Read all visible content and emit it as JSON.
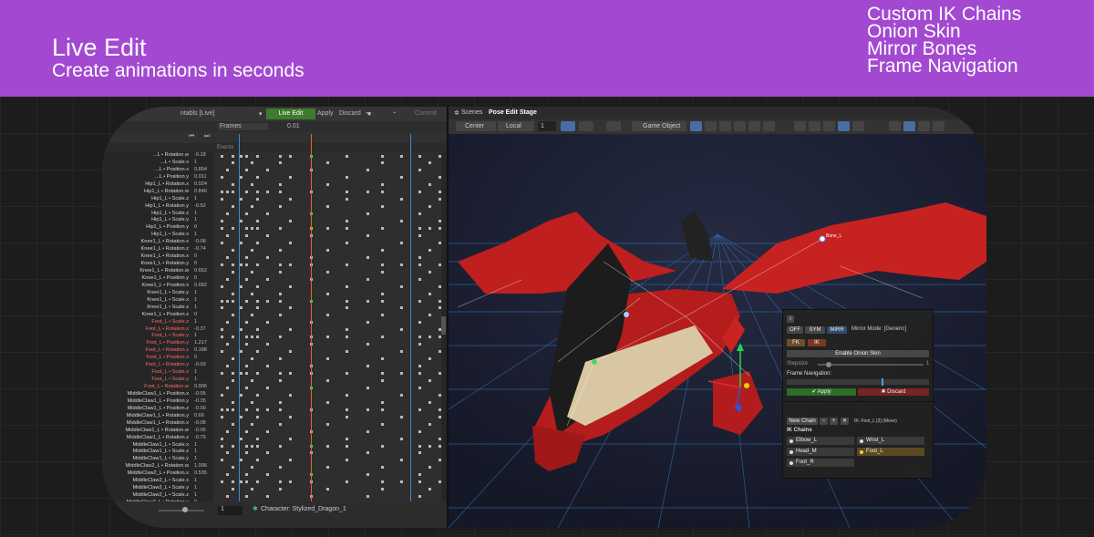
{
  "banner": {
    "title": "Live Edit",
    "subtitle": "Create animations in seconds",
    "features": [
      "Custom IK Chains",
      "Onion Skin",
      "Mirror Bones",
      "Frame Navigation"
    ],
    "bg_color": "#a349d1"
  },
  "animation_window": {
    "clip_label": "ntabls [Live]",
    "live_edit_label": "Live Edit",
    "apply_label": "Apply",
    "discard_label": "Discard",
    "commit_label": "Commit",
    "frames_label": "Frames",
    "frame_value": "0.01",
    "events_label": "Events",
    "properties": [
      {
        "name": "...L • Rotation.w",
        "value": "-0.18",
        "red": false
      },
      {
        "name": "...L • Scale.x",
        "value": "1",
        "red": false
      },
      {
        "name": "...L • Position.x",
        "value": "0.894",
        "red": false
      },
      {
        "name": "...L • Position.y",
        "value": "0.011",
        "red": false
      },
      {
        "name": "Hip1_L • Rotation.x",
        "value": "0.024",
        "red": false
      },
      {
        "name": "Hip1_L • Rotation.w",
        "value": "0.846",
        "red": false
      },
      {
        "name": "Hip1_L • Scale.z",
        "value": "1",
        "red": false
      },
      {
        "name": "Hip1_L • Rotation.y",
        "value": "-0.52",
        "red": false
      },
      {
        "name": "Hip1_L • Scale.z",
        "value": "1",
        "red": false
      },
      {
        "name": "Hip1_L • Scale.y",
        "value": "1",
        "red": false
      },
      {
        "name": "Hip1_L • Position.y",
        "value": "0",
        "red": false
      },
      {
        "name": "Hip1_L • Scale.x",
        "value": "1",
        "red": false
      },
      {
        "name": "Knee1_L • Rotation.x",
        "value": "-0.08",
        "red": false
      },
      {
        "name": "Knee1_L • Rotation.z",
        "value": "-0.74",
        "red": false
      },
      {
        "name": "Knee1_L • Rotation.x",
        "value": "0",
        "red": false
      },
      {
        "name": "Knee1_L • Rotation.y",
        "value": "0",
        "red": false
      },
      {
        "name": "Knee1_L • Rotation.w",
        "value": "0.662",
        "red": false
      },
      {
        "name": "Knee1_L • Position.y",
        "value": "0",
        "red": false
      },
      {
        "name": "Knee1_L • Position.x",
        "value": "0.682",
        "red": false
      },
      {
        "name": "Knee1_L • Scale.y",
        "value": "1",
        "red": false
      },
      {
        "name": "Knee1_L • Scale.x",
        "value": "1",
        "red": false
      },
      {
        "name": "Knee1_L • Scale.z",
        "value": "1",
        "red": false
      },
      {
        "name": "Knee1_L • Position.z",
        "value": "0",
        "red": false
      },
      {
        "name": "Foot_L • Scale.z",
        "value": "1",
        "red": true
      },
      {
        "name": "Foot_L • Rotation.x",
        "value": "-0.37",
        "red": true
      },
      {
        "name": "Foot_L • Scale.y",
        "value": "1",
        "red": true
      },
      {
        "name": "Foot_L • Position.y",
        "value": "1.217",
        "red": true
      },
      {
        "name": "Foot_L • Rotation.z",
        "value": "0.188",
        "red": true
      },
      {
        "name": "Foot_L • Position.x",
        "value": "0",
        "red": true
      },
      {
        "name": "Foot_L • Rotation.y",
        "value": "-0.03",
        "red": true
      },
      {
        "name": "Foot_L • Scale.x",
        "value": "1",
        "red": true
      },
      {
        "name": "Foot_L • Scale.y",
        "value": "1",
        "red": true
      },
      {
        "name": "Foot_L • Rotation.w",
        "value": "0.906",
        "red": true
      },
      {
        "name": "MiddleClaw1_L • Position.x",
        "value": "-0.05",
        "red": false
      },
      {
        "name": "MiddleClaw1_L • Position.y",
        "value": "-0.35",
        "red": false
      },
      {
        "name": "MiddleClaw1_L • Position.z",
        "value": "-0.00",
        "red": false
      },
      {
        "name": "MiddleClaw1_L • Rotation.y",
        "value": "0.66",
        "red": false
      },
      {
        "name": "MiddleClaw1_L • Rotation.x",
        "value": "-0.08",
        "red": false
      },
      {
        "name": "MiddleClaw1_L • Rotation.w",
        "value": "-0.05",
        "red": false
      },
      {
        "name": "MiddleClaw1_L • Rotation.z",
        "value": "-0.75",
        "red": false
      },
      {
        "name": "MiddleClaw1_L • Scale.x",
        "value": "1",
        "red": false
      },
      {
        "name": "MiddleClaw1_L • Scale.z",
        "value": "1",
        "red": false
      },
      {
        "name": "MiddleClaw1_L • Scale.y",
        "value": "1",
        "red": false
      },
      {
        "name": "MiddleClaw2_L • Rotation.w",
        "value": "1.006",
        "red": false
      },
      {
        "name": "MiddleClaw2_L • Position.x",
        "value": "0.535",
        "red": false
      },
      {
        "name": "MiddleClaw2_L • Scale.x",
        "value": "1",
        "red": false
      },
      {
        "name": "MiddleClaw2_L • Scale.y",
        "value": "1",
        "red": false
      },
      {
        "name": "MiddleClaw2_L • Scale.z",
        "value": "1",
        "red": false
      },
      {
        "name": "MiddleClaw2_L • Rotation.y",
        "value": "0",
        "red": false
      }
    ],
    "bottom_value": "1",
    "character_label": "Character: Stylized_Dragon_1"
  },
  "scene_view": {
    "scenes_label": "Scenes",
    "stage_label": "Pose Edit Stage",
    "center_label": "Center",
    "local_label": "Local",
    "snap_value": "1",
    "game_object_label": "Game Object",
    "bone_label": "Bone_L"
  },
  "pose_panel": {
    "info_label": "i",
    "mirror_buttons": [
      "OFF",
      "SYM",
      "MIRR"
    ],
    "mirror_mode_label": "Mirror Mode: [Generic]",
    "fk_label": "FK",
    "ik_label": "IK",
    "onion_label": "Enable Onion Skin",
    "stepsize_label": "Stepsize",
    "stepsize_value": "1",
    "stepsize_fraction": 0.1,
    "frame_nav_label": "Frame Navigation:",
    "apply_label": "✔ Apply",
    "discard_label": "✖ Discard",
    "new_chain_label": "New Chain",
    "minus_label": "−",
    "plus_label": "+",
    "close_label": "✕",
    "ik_info": "IK: Foot_L [3] (Move)",
    "ik_chains_title": "IK Chains",
    "chains": [
      "Elbow_L",
      "Wrist_L",
      "Head_M",
      "Foot_L",
      "Foot_R"
    ],
    "selected_chain": "Foot_L"
  }
}
